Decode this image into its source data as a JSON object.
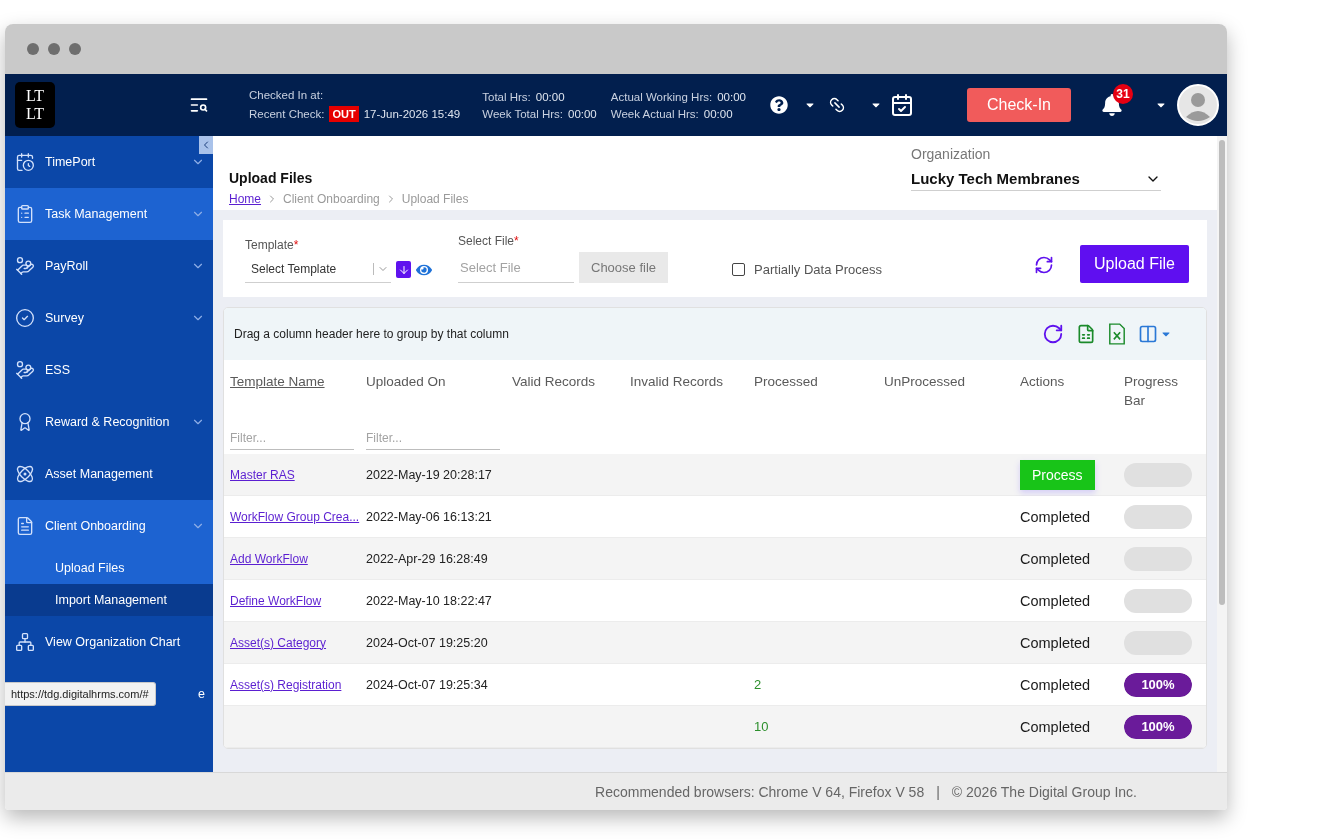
{
  "browser": {
    "status_url": "https://tdg.digitalhrms.com/#"
  },
  "header": {
    "logo_lines": [
      "LT",
      "LT"
    ],
    "checked_in_label": "Checked In at:",
    "recent_check_label": "Recent Check:",
    "recent_check_status": "OUT",
    "recent_check_time": "17-Jun-2026 15:49",
    "hours": [
      {
        "lines": [
          {
            "label": "Total Hrs:",
            "value": "00:00"
          },
          {
            "label": "Week Total Hrs:",
            "value": "00:00"
          }
        ]
      },
      {
        "lines": [
          {
            "label": "Actual Working Hrs:",
            "value": "00:00"
          },
          {
            "label": "Week Actual Hrs:",
            "value": "00:00"
          }
        ]
      }
    ],
    "check_in_button": "Check-In",
    "notification_count": "31"
  },
  "sidebar": {
    "items": [
      {
        "label": "TimePort",
        "active": false,
        "collapsible": true,
        "covered": false
      },
      {
        "label": "Task Management",
        "active": true,
        "collapsible": true,
        "covered": false
      },
      {
        "label": "PayRoll",
        "active": false,
        "collapsible": true,
        "covered": false
      },
      {
        "label": "Survey",
        "active": false,
        "collapsible": true,
        "covered": false
      },
      {
        "label": "ESS",
        "active": false,
        "collapsible": false,
        "covered": false
      },
      {
        "label": "Reward & Recognition",
        "active": false,
        "collapsible": true,
        "covered": false
      },
      {
        "label": "Asset Management",
        "active": false,
        "collapsible": false,
        "covered": false
      },
      {
        "label": "Client Onboarding",
        "active": true,
        "collapsible": true,
        "covered": false,
        "children": [
          {
            "label": "Upload Files",
            "selected": true
          },
          {
            "label": "Import Management",
            "selected": false
          }
        ]
      },
      {
        "label": "View Organization Chart",
        "active": false,
        "collapsible": false,
        "covered": false
      },
      {
        "label": "e",
        "active": false,
        "collapsible": false,
        "covered": true
      }
    ]
  },
  "page": {
    "title": "Upload Files",
    "breadcrumb": [
      {
        "label": "Home",
        "link": true
      },
      {
        "label": "Client Onboarding",
        "link": false
      },
      {
        "label": "Upload Files",
        "link": false
      }
    ],
    "organization": {
      "label": "Organization",
      "value": "Lucky Tech Membranes"
    }
  },
  "form": {
    "template": {
      "label": "Template",
      "required_mark": "*",
      "placeholder": "Select Template"
    },
    "file": {
      "label": "Select File",
      "required_mark": "*",
      "placeholder": "Select File",
      "button": "Choose file"
    },
    "partial_process": {
      "label": "Partially Data Process",
      "checked": false
    },
    "upload_button": "Upload File"
  },
  "grid": {
    "group_panel": "Drag a column header here to group by that column",
    "columns": [
      {
        "label": "Template Name",
        "sortable": true
      },
      {
        "label": "Uploaded On",
        "sortable": false
      },
      {
        "label": "Valid Records",
        "sortable": false
      },
      {
        "label": "Invalid Records",
        "sortable": false
      },
      {
        "label": "Processed",
        "sortable": false
      },
      {
        "label": "UnProcessed",
        "sortable": false
      },
      {
        "label": "Actions",
        "sortable": false
      },
      {
        "label": "Progress Bar",
        "sortable": false
      }
    ],
    "filters": [
      {
        "placeholder": "Filter..."
      },
      {
        "placeholder": "Filter..."
      }
    ],
    "rows": [
      {
        "template_name": "Master RAS",
        "uploaded_on": "2022-May-19 20:28:17",
        "action": {
          "kind": "button",
          "label": "Process"
        },
        "progress": {
          "level": 0
        }
      },
      {
        "template_name": "WorkFlow Group Crea...",
        "uploaded_on": "2022-May-06 16:13:21",
        "action": {
          "kind": "status",
          "label": "Completed"
        },
        "progress": {
          "level": 0
        }
      },
      {
        "template_name": "Add WorkFlow",
        "uploaded_on": "2022-Apr-29 16:28:49",
        "action": {
          "kind": "status",
          "label": "Completed"
        },
        "progress": {
          "level": 0
        }
      },
      {
        "template_name": "Define WorkFlow",
        "uploaded_on": "2022-May-10 18:22:47",
        "action": {
          "kind": "status",
          "label": "Completed"
        },
        "progress": {
          "level": 0
        }
      },
      {
        "template_name": "Asset(s) Category",
        "uploaded_on": "2024-Oct-07 19:25:20",
        "action": {
          "kind": "status",
          "label": "Completed"
        },
        "progress": {
          "level": 0
        }
      },
      {
        "template_name": "Asset(s) Registration",
        "uploaded_on": "2024-Oct-07 19:25:34",
        "processed": "2",
        "action": {
          "kind": "status",
          "label": "Completed"
        },
        "progress": {
          "level": 1,
          "label": "100%"
        }
      },
      {
        "processed": "10",
        "action": {
          "kind": "status",
          "label": "Completed"
        },
        "progress": {
          "level": 1,
          "label": "100%"
        }
      }
    ]
  },
  "footer": {
    "browsers": "Recommended browsers: Chrome V 64, Firefox V 58",
    "separator": "|",
    "copyright": "© 2026 The Digital Group Inc."
  }
}
